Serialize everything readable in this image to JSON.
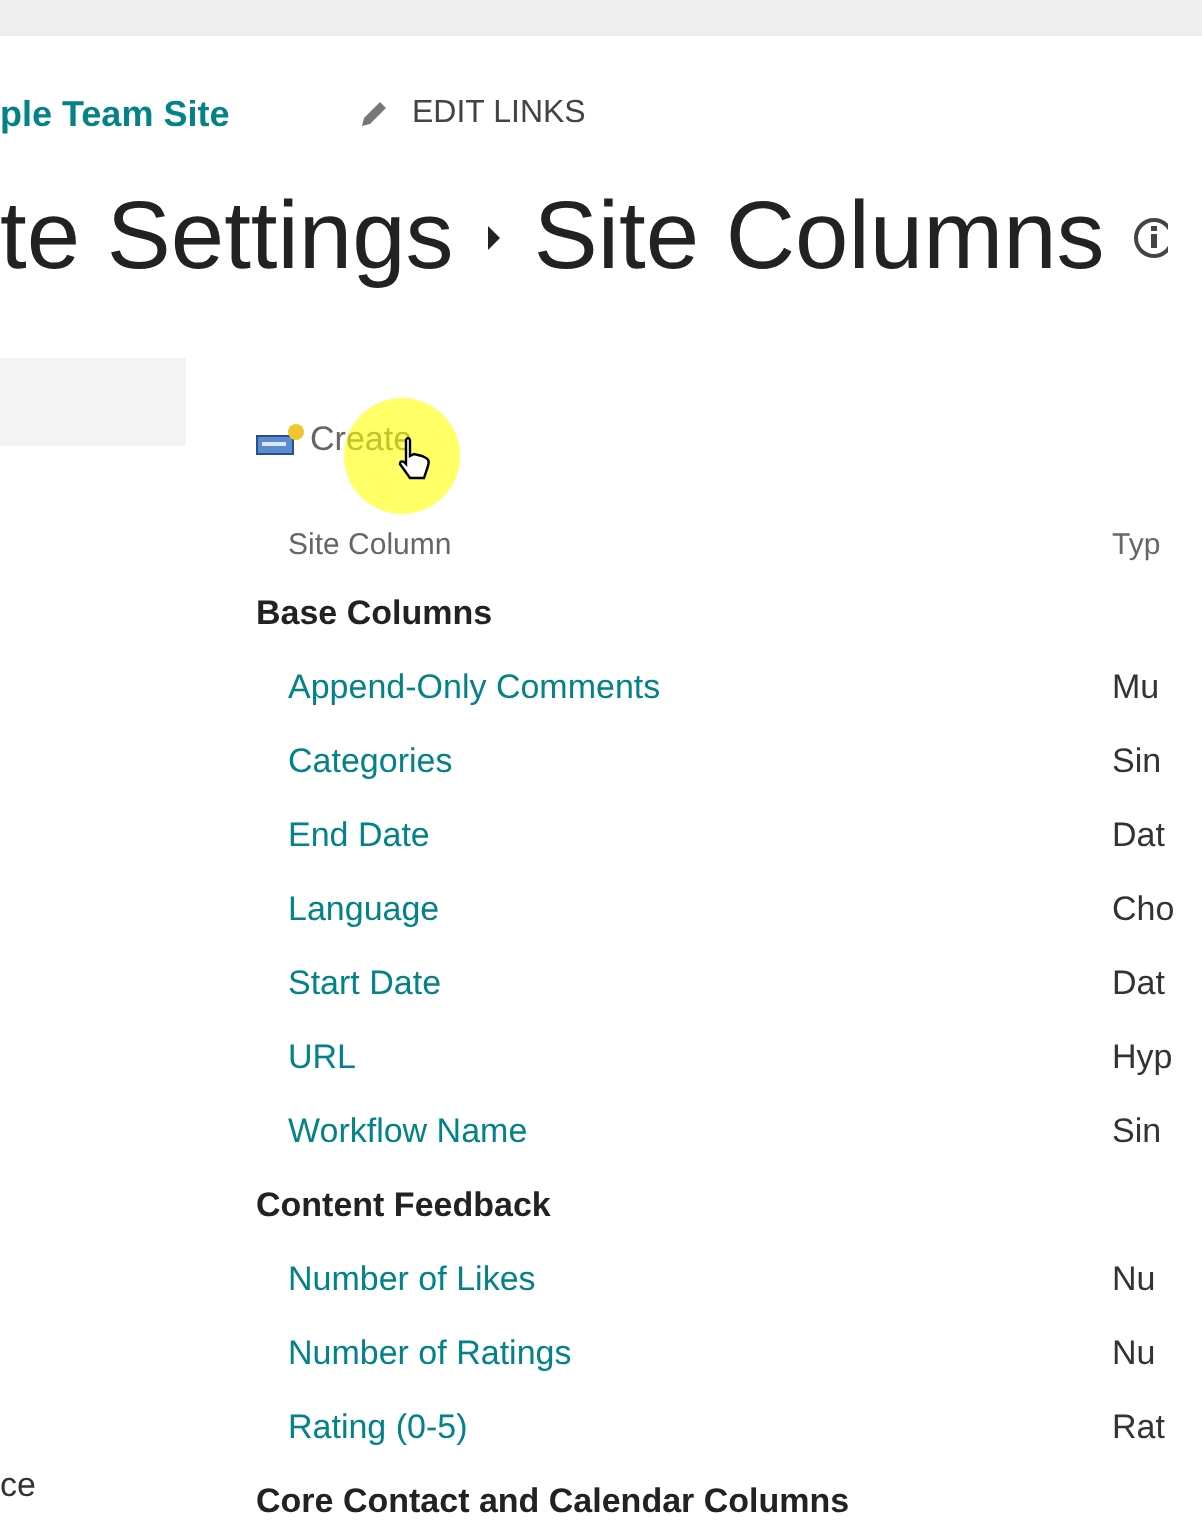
{
  "site_title": "ple Team Site",
  "edit_links": "EDIT LINKS",
  "page_title": {
    "parent": "te Settings",
    "current": "Site Columns"
  },
  "left_nav": {
    "items": [
      "ce"
    ]
  },
  "create_link": "Create",
  "table": {
    "columns": [
      "Site Column",
      "Typ"
    ],
    "groups": [
      {
        "name": "Base Columns",
        "rows": [
          {
            "name": "Append-Only Comments",
            "type": "Mu"
          },
          {
            "name": "Categories",
            "type": "Sin"
          },
          {
            "name": "End Date",
            "type": "Dat"
          },
          {
            "name": "Language",
            "type": "Cho"
          },
          {
            "name": "Start Date",
            "type": "Dat"
          },
          {
            "name": "URL",
            "type": "Hyp"
          },
          {
            "name": "Workflow Name",
            "type": "Sin"
          }
        ]
      },
      {
        "name": "Content Feedback",
        "rows": [
          {
            "name": "Number of Likes",
            "type": "Nu"
          },
          {
            "name": "Number of Ratings",
            "type": "Nu"
          },
          {
            "name": "Rating (0-5)",
            "type": "Rat"
          }
        ]
      },
      {
        "name": "Core Contact and Calendar Columns"
      }
    ]
  }
}
